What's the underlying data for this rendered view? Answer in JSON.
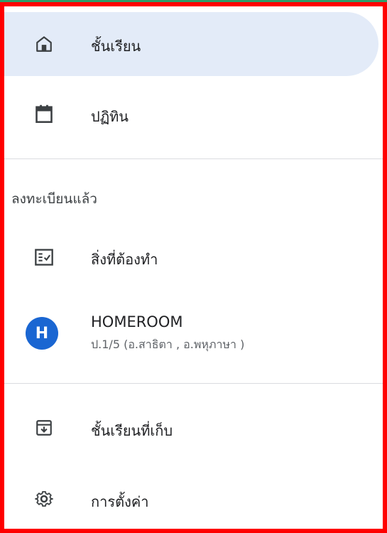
{
  "nav": {
    "classes_label": "ชั้นเรียน",
    "calendar_label": "ปฏิทิน",
    "enrolled_section_title": "ลงทะเบียนแล้ว",
    "todo_label": "สิ่งที่ต้องทำ",
    "homeroom": {
      "avatar_letter": "H",
      "name": "HOMEROOM",
      "subtitle": "ป.1/5 (อ.สาธิตา , อ.พหุภาษา )",
      "avatar_color": "#1a66d2"
    },
    "archived_label": "ชั้นเรียนที่เก็บ",
    "settings_label": "การตั้งค่า"
  },
  "colors": {
    "active_bg": "#e3ebf8",
    "frame_border": "#ff0000",
    "top_strip": "#2e9e6b"
  },
  "icons": {
    "classes": "home-icon",
    "calendar": "calendar-icon",
    "todo": "todo-checklist-icon",
    "archived": "archive-icon",
    "settings": "gear-icon"
  }
}
